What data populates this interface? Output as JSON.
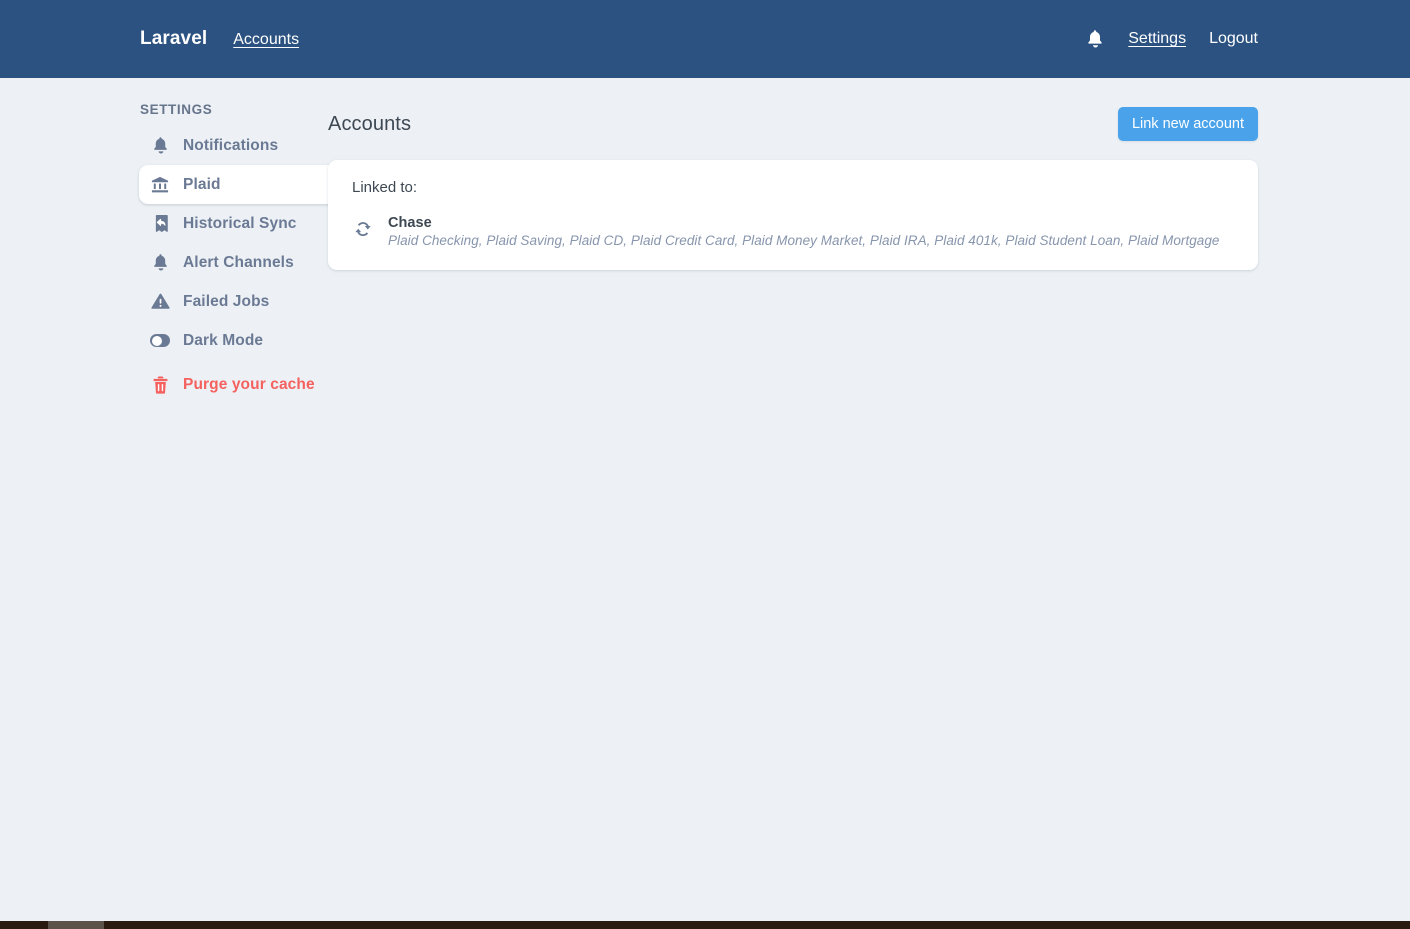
{
  "navbar": {
    "brand": "Laravel",
    "primary_link": "Accounts",
    "bell_icon": "bell-icon",
    "settings_link": "Settings",
    "logout_link": "Logout"
  },
  "sidebar": {
    "heading": "SETTINGS",
    "items": [
      {
        "label": "Notifications",
        "icon": "bell-icon",
        "active": false,
        "danger": false
      },
      {
        "label": "Plaid",
        "icon": "bank-icon",
        "active": true,
        "danger": false
      },
      {
        "label": "Historical Sync",
        "icon": "history-icon",
        "active": false,
        "danger": false
      },
      {
        "label": "Alert Channels",
        "icon": "bell-icon",
        "active": false,
        "danger": false
      },
      {
        "label": "Failed Jobs",
        "icon": "warning-triangle-icon",
        "active": false,
        "danger": false
      },
      {
        "label": "Dark Mode",
        "icon": "toggle-switch-icon",
        "active": false,
        "danger": false
      },
      {
        "label": "Purge your cache",
        "icon": "trash-icon",
        "active": false,
        "danger": true
      }
    ]
  },
  "main": {
    "title": "Accounts",
    "link_button": "Link new account",
    "card": {
      "label": "Linked to:",
      "accounts": [
        {
          "icon": "sync-icon",
          "name": "Chase",
          "subaccounts": "Plaid Checking, Plaid Saving, Plaid CD, Plaid Credit Card, Plaid Money Market, Plaid IRA, Plaid 401k, Plaid Student Loan, Plaid Mortgage"
        }
      ]
    }
  },
  "colors": {
    "navbar_bg": "#2b5280",
    "page_bg": "#edf1f5",
    "accent_blue": "#4aa3ea",
    "danger_red": "#f4615f",
    "sidebar_text": "#6b7a94",
    "card_bg": "#ffffff"
  }
}
